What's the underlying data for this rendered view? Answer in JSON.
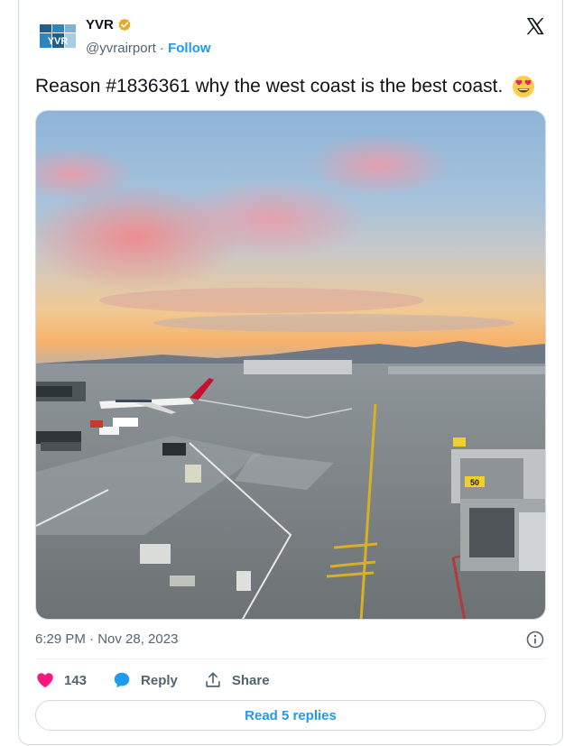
{
  "author": {
    "name": "YVR",
    "handle": "@yvrairport",
    "separator": "·",
    "follow_label": "Follow",
    "avatar_text": "YVR"
  },
  "tweet": {
    "text": "Reason #1836361 why the west coast is the best coast.",
    "emoji": "smiling-face-with-heart-eyes",
    "timestamp": "6:29 PM · Nov 28, 2023",
    "gate_sign": "50"
  },
  "actions": {
    "like_count": "143",
    "reply_label": "Reply",
    "share_label": "Share",
    "read_replies_label": "Read 5 replies"
  },
  "colors": {
    "accent": "#1d9bf0",
    "like": "#f91880",
    "verified": "#e8a826",
    "text": "#0f1419",
    "muted": "#536471"
  }
}
